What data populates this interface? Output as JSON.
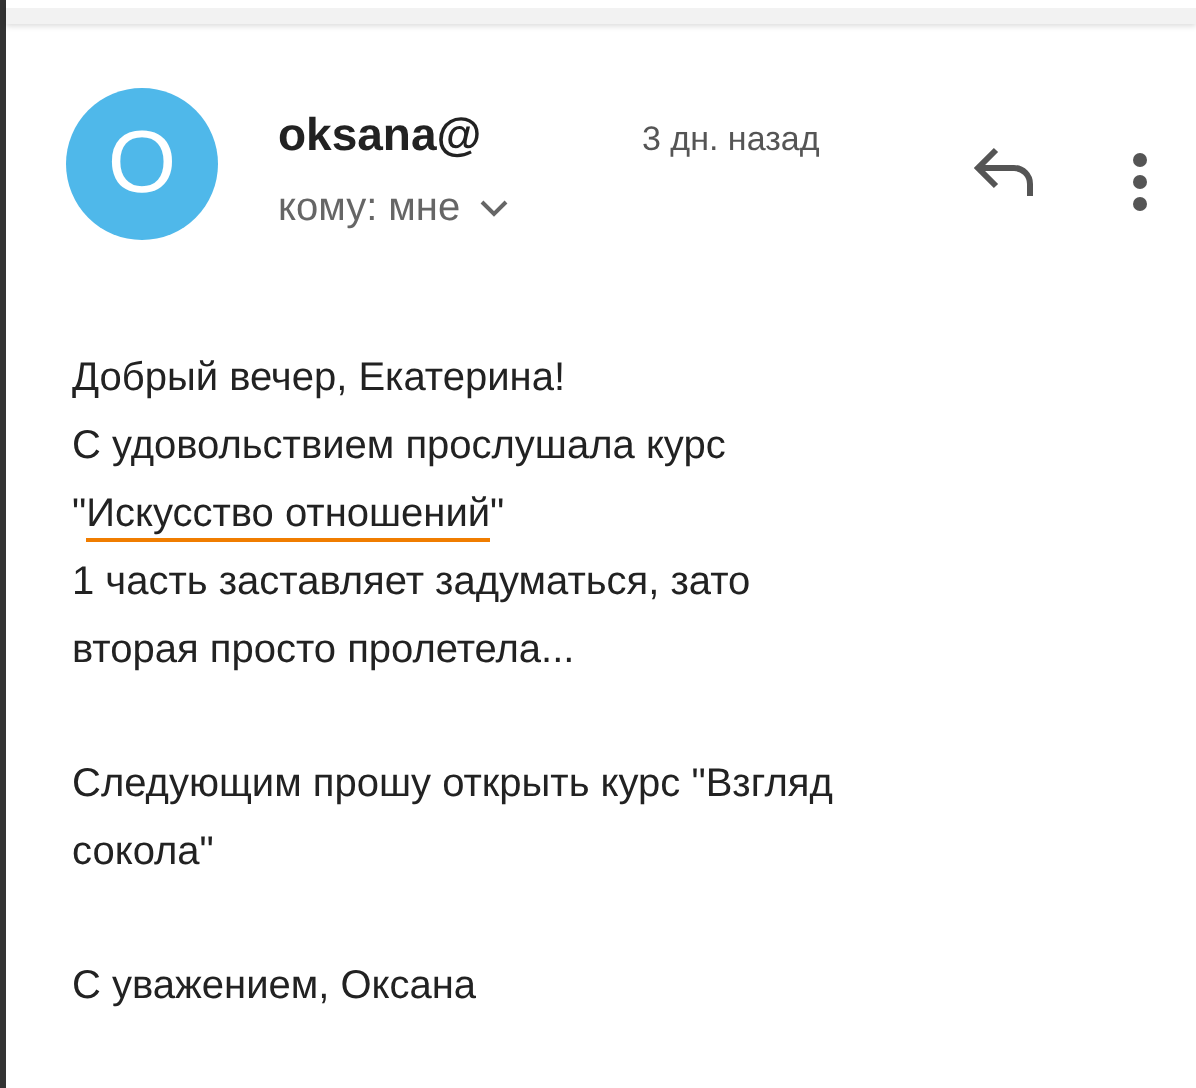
{
  "message": {
    "sender": "oksana@",
    "time": "3 дн. назад",
    "recipient": "кому: мне",
    "avatar_letter": "O",
    "paragraphs": [
      {
        "lines": [
          {
            "parts": [
              {
                "text": "Добрый вечер, Екатерина!",
                "underline": false
              }
            ]
          },
          {
            "parts": [
              {
                "text": "С удовольствием прослушала курс",
                "underline": false
              }
            ]
          },
          {
            "parts": [
              {
                "text": "\"",
                "underline": false
              },
              {
                "text": "Искусство отношений",
                "underline": true
              },
              {
                "text": "\"",
                "underline": false
              }
            ]
          },
          {
            "parts": [
              {
                "text": "1 часть заставляет задуматься, зато",
                "underline": false
              }
            ]
          },
          {
            "parts": [
              {
                "text": "вторая просто пролетела...",
                "underline": false
              }
            ]
          }
        ]
      },
      {
        "lines": [
          {
            "parts": [
              {
                "text": "Следующим прошу открыть курс \"Взгляд",
                "underline": false
              }
            ]
          },
          {
            "parts": [
              {
                "text": "сокола\"",
                "underline": false
              }
            ]
          }
        ]
      },
      {
        "lines": [
          {
            "parts": [
              {
                "text": "С уважением, Оксана",
                "underline": false
              }
            ]
          }
        ]
      }
    ]
  }
}
